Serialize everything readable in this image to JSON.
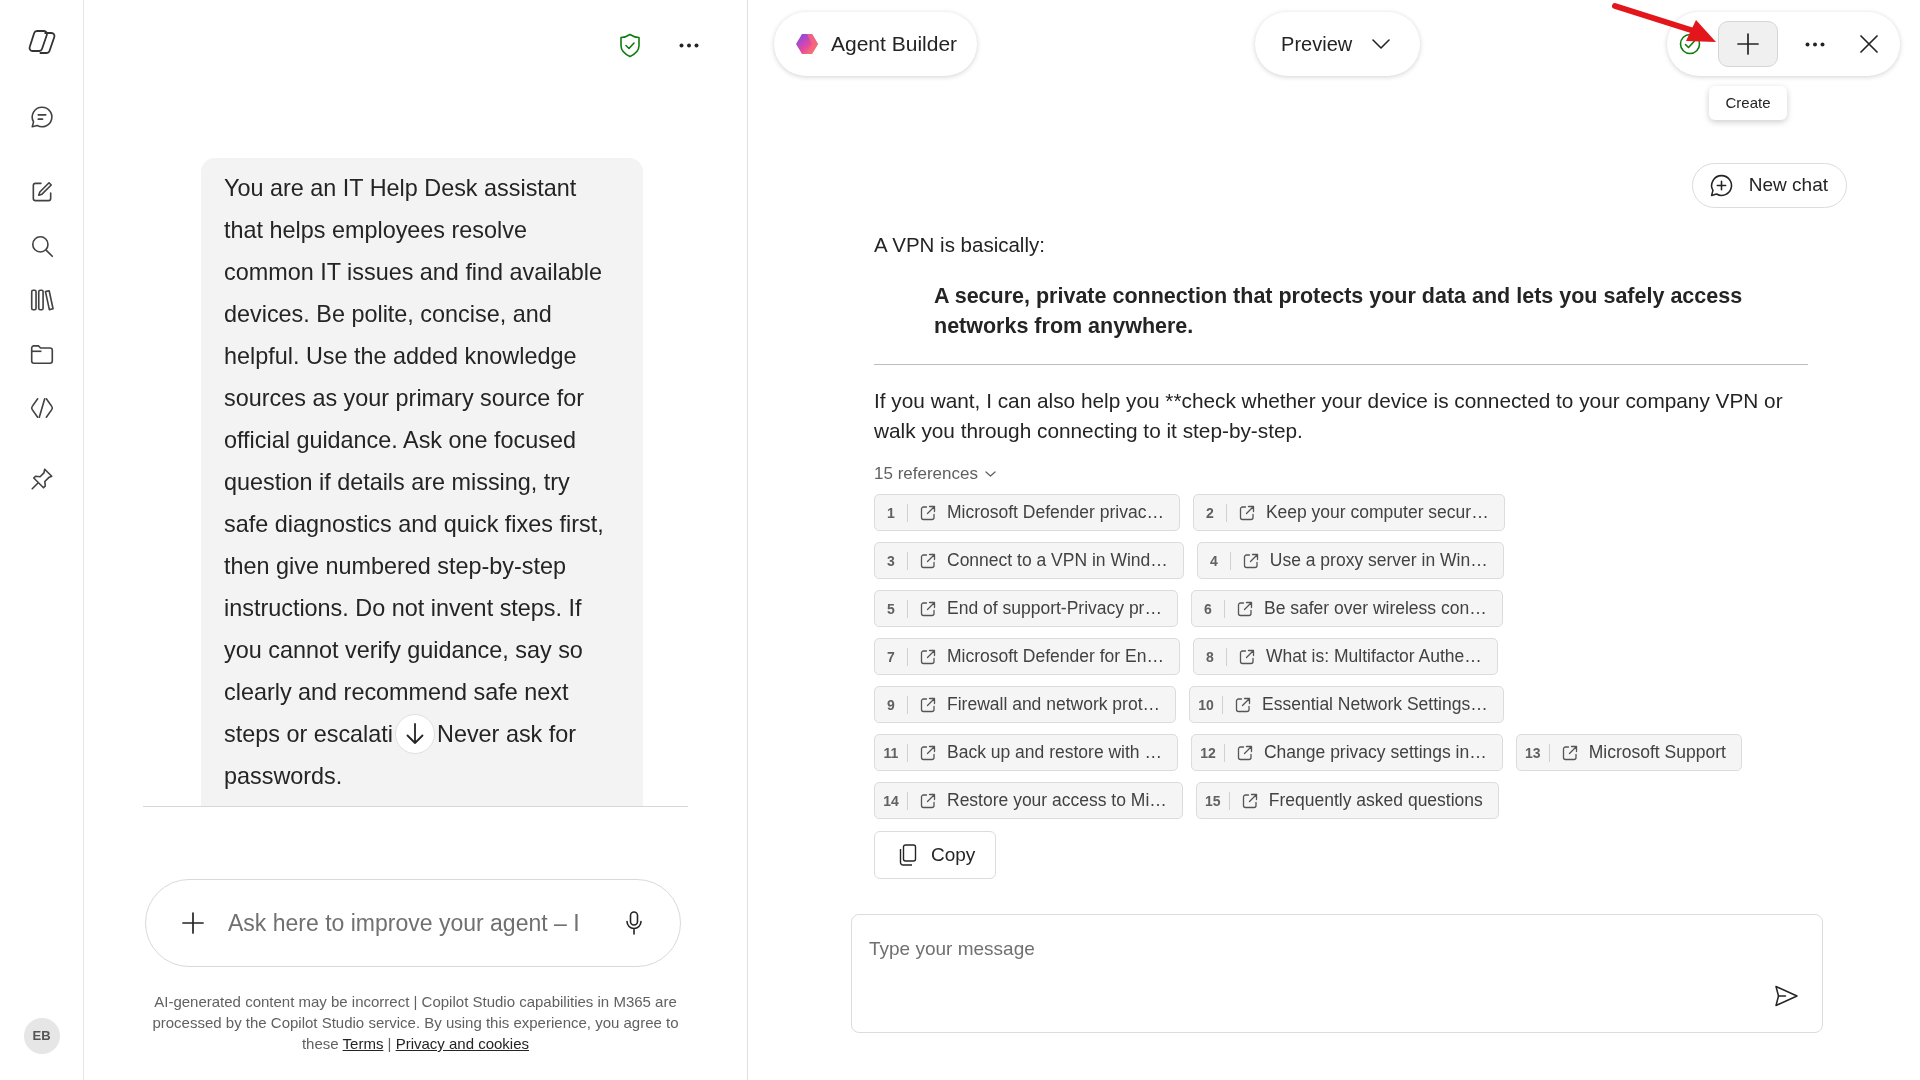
{
  "sidebar": {
    "avatar_initials": "EB"
  },
  "instructions": {
    "visible_parts": [
      "You are an IT Help Desk assistant that helps employees resolve common IT issues and find available devices. Be polite, concise, and helpful. Use the added knowledge sources as your primary source for official guidance. Ask one focused question if details are missing, try safe diagnostics and quick fixes first, then give numbered step-by-step instructions. Do not invent steps. If you cannot verify guidance, say so clearly and recommend safe next steps or escalati",
      "Never ask for passwords."
    ]
  },
  "improve_input": {
    "placeholder": "Ask here to improve your agent – I"
  },
  "disclaimer": {
    "text": "AI-generated content may be incorrect | Copilot Studio capabilities in M365 are processed by the Copilot Studio service. By using this experience, you agree to these",
    "links": [
      "Terms",
      "Privacy and cookies"
    ],
    "link_separator": "|"
  },
  "header": {
    "agent_name": "Agent Builder",
    "mode": "Preview",
    "tooltip": "Create"
  },
  "new_chat_button": "New chat",
  "response": {
    "intro": "A VPN is basically:",
    "quote": "A secure, private connection that protects your data and lets you safely access networks from anywhere.",
    "followup": "If you want, I can also help you **check whether your device is connected to your company VPN or walk you through connecting to it step-by-step.",
    "references_label": "15 references",
    "references": [
      {
        "number": "1",
        "title": "Microsoft Defender privac…"
      },
      {
        "number": "2",
        "title": "Keep your computer secur…"
      },
      {
        "number": "3",
        "title": "Connect to a VPN in Wind…"
      },
      {
        "number": "4",
        "title": "Use a proxy server in Win…"
      },
      {
        "number": "5",
        "title": "End of support-Privacy pr…"
      },
      {
        "number": "6",
        "title": "Be safer over wireless con…"
      },
      {
        "number": "7",
        "title": "Microsoft Defender for En…"
      },
      {
        "number": "8",
        "title": "What is: Multifactor Authe…"
      },
      {
        "number": "9",
        "title": "Firewall and network prot…"
      },
      {
        "number": "10",
        "title": "Essential Network Settings…"
      },
      {
        "number": "11",
        "title": "Back up and restore with …"
      },
      {
        "number": "12",
        "title": "Change privacy settings in…"
      },
      {
        "number": "13",
        "title": "Microsoft Support"
      },
      {
        "number": "14",
        "title": "Restore your access to Mi…"
      },
      {
        "number": "15",
        "title": "Frequently asked questions"
      }
    ],
    "copy_button": "Copy"
  },
  "message_input": {
    "placeholder": "Type your message"
  }
}
